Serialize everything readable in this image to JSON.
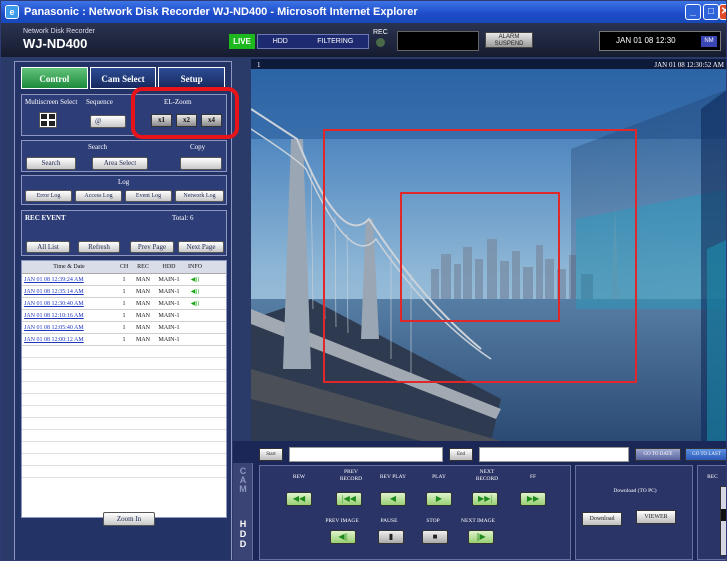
{
  "window": {
    "title": "Panasonic : Network Disk Recorder WJ-ND400 - Microsoft Internet Explorer"
  },
  "header": {
    "subtitle": "Network Disk Recorder",
    "model": "WJ-ND400",
    "live": "LIVE",
    "hdd": "HDD",
    "filtering": "FILTERING",
    "rec": "REC",
    "alarm_line1": "ALARM",
    "alarm_line2": "SUSPEND",
    "datetime": "JAN 01 08  12:30",
    "datetime_badge": "NM"
  },
  "tabs": {
    "control": "Control",
    "cam_select": "Cam Select",
    "setup": "Setup"
  },
  "controls": {
    "multiscreen_label": "Multiscreen Select",
    "sequence_label": "Sequence",
    "sequence_btn": "@",
    "elzoom_label": "EL-Zoom",
    "zoom_x1": "x1",
    "zoom_x2": "x2",
    "zoom_x4": "x4",
    "search_label": "Search",
    "copy_label": "Copy",
    "search_btn": "Search",
    "area_select_btn": "Area Select",
    "log_label": "Log",
    "error_log": "Error Log",
    "access_log": "Access Log",
    "event_log": "Event Log",
    "network_log": "Network Log",
    "rec_event_label": "REC EVENT",
    "total": "Total: 6",
    "all_list": "All List",
    "refresh": "Refresh",
    "prev_page": "Prev Page",
    "next_page": "Next Page",
    "zoom_in": "Zoom In"
  },
  "log_table": {
    "headers": [
      "Time & Date",
      "CH",
      "REC",
      "HDD",
      "INFO"
    ],
    "rows": [
      [
        "JAN 01 08  12:39:24 AM",
        "1",
        "MAN",
        "MAIN-1",
        "◀))"
      ],
      [
        "JAN 01 08  12:35:14 AM",
        "1",
        "MAN",
        "MAIN-1",
        "◀))"
      ],
      [
        "JAN 01 08  12:30:40 AM",
        "1",
        "MAN",
        "MAIN-1",
        "◀))"
      ],
      [
        "JAN 01 08  12:10:16 AM",
        "1",
        "MAN",
        "MAIN-1",
        ""
      ],
      [
        "JAN 01 08  12:05:40 AM",
        "1",
        "MAN",
        "MAIN-1",
        ""
      ],
      [
        "JAN 01 08  12:00:12 AM",
        "1",
        "MAN",
        "MAIN-1",
        ""
      ]
    ]
  },
  "viewer": {
    "camera": "1",
    "timestamp": "JAN 01 08  12:30:52 AM"
  },
  "playback": {
    "start_btn": "Start",
    "end_btn": "End",
    "go_to_date": "GO TO DATE",
    "go_to_last": "GO TO LAST",
    "cam_label": "CAM",
    "hdd_label": "HDD",
    "rew": "REW",
    "prev_record": "PREV RECORD",
    "rev_play": "REV PLAY",
    "play": "PLAY",
    "next_record": "NEXT RECORD",
    "ff": "FF",
    "prev_image": "PREV IMAGE",
    "pause": "PAUSE",
    "stop": "STOP",
    "next_image": "NEXT IMAGE",
    "download_title": "Download (TO PC)",
    "download_btn": "Download",
    "viewer_btn": "VIEWER",
    "rec_title": "REC"
  },
  "colors": {
    "live": "#1db81d",
    "highlight": "#e8141a",
    "panel": "#243366",
    "zoom_frame": "#e0282a"
  }
}
